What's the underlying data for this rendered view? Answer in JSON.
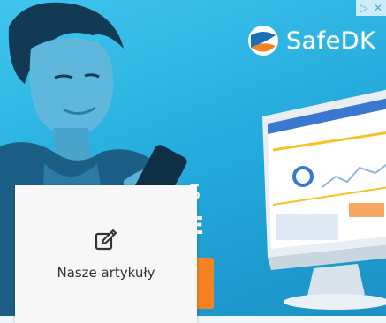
{
  "ad": {
    "brand": "SafeDK",
    "headline_line1": "S",
    "headline_line2": "E",
    "adchoices": {
      "info_glyph": "▷",
      "close_glyph": "✕"
    }
  },
  "card": {
    "label": "Nasze artykuły",
    "icon": "edit-icon"
  }
}
